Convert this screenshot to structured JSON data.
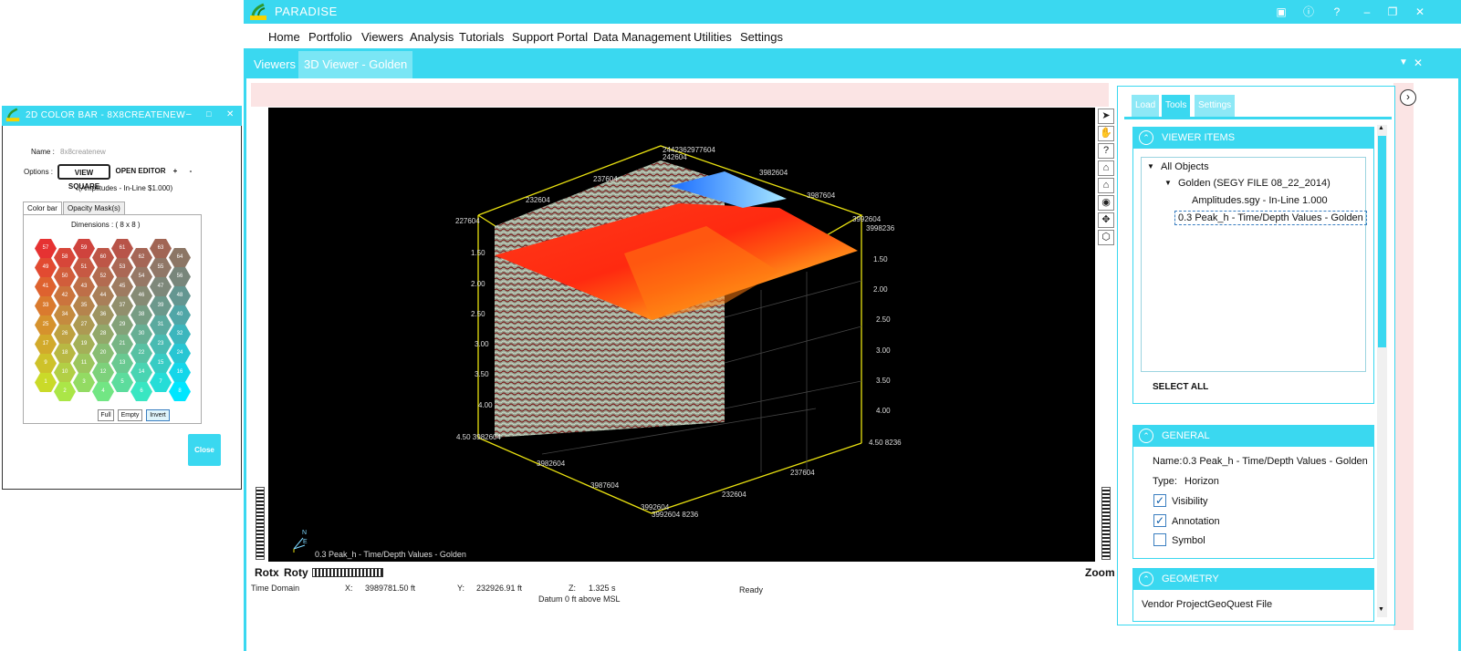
{
  "app": {
    "title": "PARADISE",
    "window_controls": [
      "camera-icon",
      "info-icon",
      "help-icon",
      "minimize-icon",
      "restore-icon",
      "close-icon"
    ]
  },
  "menu": [
    "Home",
    "Portfolio",
    "Viewers",
    "Analysis",
    "Tutorials",
    "Support Portal",
    "Data Management",
    "Utilities",
    "Settings"
  ],
  "window_tabs": [
    {
      "label": "Viewers",
      "active": false
    },
    {
      "label": "3D Viewer - Golden",
      "active": true
    }
  ],
  "viewer": {
    "overlay_label": "0.3 Peak_h - Time/Depth Values - Golden",
    "axis_labels_left": [
      "1.50",
      "2.00",
      "2.50",
      "3.00",
      "3.50",
      "4.00",
      "4.50"
    ],
    "axis_labels_right": [
      "1.50",
      "2.00",
      "2.50",
      "3.00",
      "3.50",
      "4.00"
    ],
    "top_labels": [
      "2442362977604",
      "242604",
      "237604",
      "232604",
      "227604",
      "3982604",
      "3987604",
      "3992604",
      "3998236"
    ],
    "bottom_labels": [
      "3982604",
      "3987604",
      "3992604",
      "237604",
      "232604",
      "4.50 3982604",
      "4.50 8236",
      "3992604 8236"
    ],
    "compass": {
      "n": "N",
      "e": "E"
    },
    "rot_x": "Rotx",
    "rot_y": "Roty",
    "zoom": "Zoom"
  },
  "status": {
    "domain": "Time Domain",
    "x_label": "X:",
    "x_value": "3989781.50 ft",
    "y_label": "Y:",
    "y_value": "232926.91 ft",
    "z_label": "Z:",
    "z_value": "1.325 s",
    "datum": "Datum 0 ft above MSL",
    "state": "Ready"
  },
  "right_panel": {
    "tabs": [
      {
        "label": "Load",
        "active": false
      },
      {
        "label": "Tools",
        "active": true
      },
      {
        "label": "Settings",
        "active": false
      }
    ],
    "viewer_items": {
      "header": "VIEWER ITEMS",
      "tree": [
        {
          "label": "All Objects",
          "level": 0
        },
        {
          "label": "Golden (SEGY FILE 08_22_2014)",
          "level": 1
        },
        {
          "label": "Amplitudes.sgy - In-Line 1.000",
          "level": 2
        },
        {
          "label": "0.3 Peak_h - Time/Depth Values - Golden",
          "level": 2
        }
      ],
      "select_all": "SELECT ALL"
    },
    "general": {
      "header": "GENERAL",
      "name_label": "Name:",
      "name_value": "0.3 Peak_h - Time/Depth Values - Golden",
      "type_label": "Type:",
      "type_value": "Horizon",
      "checks": [
        {
          "label": "Visibility",
          "checked": true
        },
        {
          "label": "Annotation",
          "checked": true
        },
        {
          "label": "Symbol",
          "checked": false
        }
      ]
    },
    "geometry": {
      "header": "GEOMETRY",
      "vendor": "Vendor ProjectGeoQuest File"
    }
  },
  "dialog": {
    "title": "2D COLOR BAR - 8X8CREATENEW",
    "name_label": "Name :",
    "name_value": "8x8createnew",
    "options_label": "Options :",
    "view_square": "VIEW SQUARE",
    "open_editor": "OPEN EDITOR",
    "plus": "+",
    "minus": "-",
    "subtitle": "(Amplitudes - In-Line $1.000)",
    "tabs": [
      {
        "label": "Color bar",
        "active": true
      },
      {
        "label": "Opacity Mask(s)",
        "active": false
      }
    ],
    "dimensions": "Dimensions :  ( 8 x 8 )",
    "buttons": [
      "Full",
      "Empty",
      "Invert"
    ],
    "close": "Close",
    "hex_numbers": [
      [
        57,
        59,
        61,
        63
      ],
      [
        58,
        60,
        62,
        64
      ],
      [
        49,
        51,
        53,
        55
      ],
      [
        50,
        52,
        54,
        56
      ],
      [
        41,
        43,
        45,
        47
      ],
      [
        42,
        44,
        46,
        48
      ],
      [
        33,
        35,
        37,
        39
      ],
      [
        34,
        36,
        38,
        40
      ],
      [
        25,
        27,
        29,
        31
      ],
      [
        26,
        28,
        30,
        32
      ],
      [
        17,
        19,
        21,
        23
      ],
      [
        18,
        20,
        22,
        24
      ],
      [
        9,
        11,
        13,
        15
      ],
      [
        10,
        12,
        14,
        16
      ],
      [
        1,
        3,
        5,
        7
      ],
      [
        2,
        4,
        6,
        8
      ]
    ]
  },
  "colors": {
    "accent": "#3ad8f0",
    "pink": "#fbe4e4"
  }
}
